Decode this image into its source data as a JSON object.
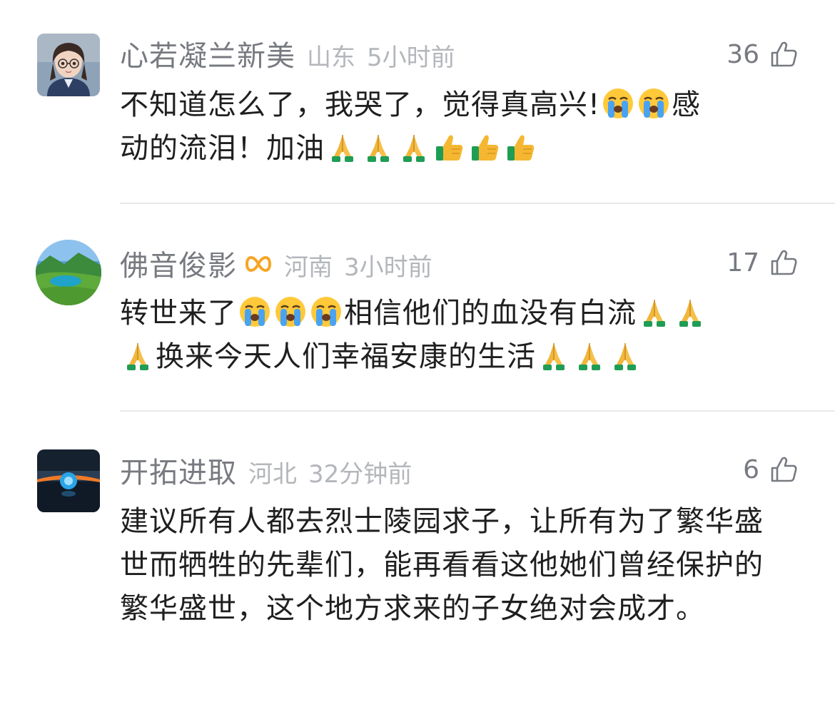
{
  "comments": [
    {
      "username": "心若凝兰新美",
      "location": "山东",
      "time": "5小时前",
      "likes": "36",
      "line1": "不知道怎么了，我哭了，觉得真高兴!",
      "line1b": "感",
      "line2": "动的流泪！加油"
    },
    {
      "username": "佛音俊影",
      "location": "河南",
      "time": "3小时前",
      "likes": "17",
      "line1": "转世来了",
      "line1b": "相信他们的血没有白流",
      "line2": "换来今天人们幸福安康的生活"
    },
    {
      "username": "开拓进取",
      "location": "河北",
      "time": "32分钟前",
      "likes": "6",
      "content": "建议所有人都去烈士陵园求子，让所有为了繁华盛世而牺牲的先辈们，能再看看这他她们曾经保护的繁华盛世，这个地方求来的子女绝对会成才。"
    }
  ],
  "colors": {
    "username": "#777a80",
    "meta": "#b3b6bb",
    "content": "#1f1f1f",
    "divider": "#e9e9eb",
    "badge": "#f5a623"
  },
  "icons": {
    "like": "thumbs-up-outline-icon",
    "crying": "loudly-crying-face-emoji",
    "praying": "folded-hands-emoji",
    "thumbs": "thumbs-up-emoji",
    "badge": "gold-infinity-badge-icon"
  }
}
